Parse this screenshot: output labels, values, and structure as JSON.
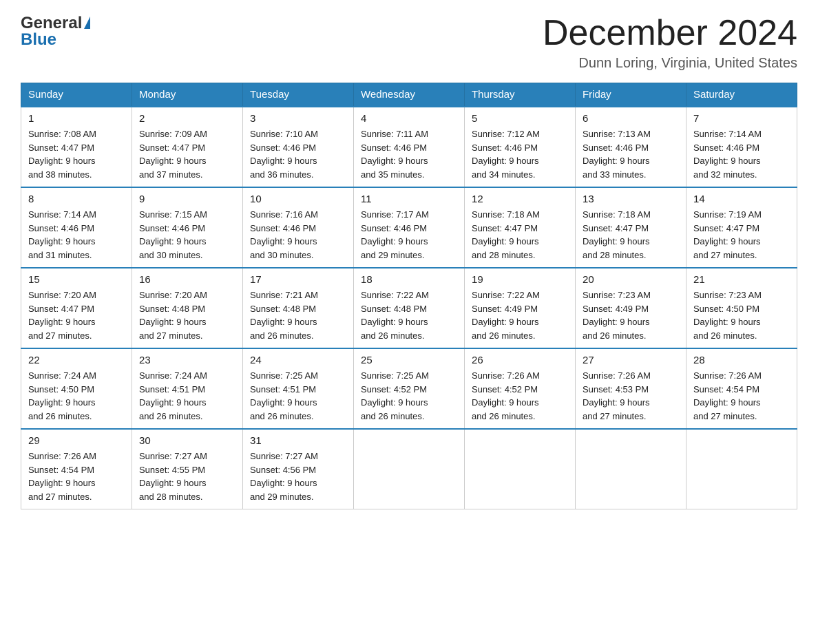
{
  "logo": {
    "line1": "General",
    "triangle": "▶",
    "line2": "Blue"
  },
  "title": "December 2024",
  "location": "Dunn Loring, Virginia, United States",
  "headers": [
    "Sunday",
    "Monday",
    "Tuesday",
    "Wednesday",
    "Thursday",
    "Friday",
    "Saturday"
  ],
  "weeks": [
    [
      {
        "day": "1",
        "sunrise": "7:08 AM",
        "sunset": "4:47 PM",
        "daylight_hours": "9",
        "daylight_minutes": "38"
      },
      {
        "day": "2",
        "sunrise": "7:09 AM",
        "sunset": "4:47 PM",
        "daylight_hours": "9",
        "daylight_minutes": "37"
      },
      {
        "day": "3",
        "sunrise": "7:10 AM",
        "sunset": "4:46 PM",
        "daylight_hours": "9",
        "daylight_minutes": "36"
      },
      {
        "day": "4",
        "sunrise": "7:11 AM",
        "sunset": "4:46 PM",
        "daylight_hours": "9",
        "daylight_minutes": "35"
      },
      {
        "day": "5",
        "sunrise": "7:12 AM",
        "sunset": "4:46 PM",
        "daylight_hours": "9",
        "daylight_minutes": "34"
      },
      {
        "day": "6",
        "sunrise": "7:13 AM",
        "sunset": "4:46 PM",
        "daylight_hours": "9",
        "daylight_minutes": "33"
      },
      {
        "day": "7",
        "sunrise": "7:14 AM",
        "sunset": "4:46 PM",
        "daylight_hours": "9",
        "daylight_minutes": "32"
      }
    ],
    [
      {
        "day": "8",
        "sunrise": "7:14 AM",
        "sunset": "4:46 PM",
        "daylight_hours": "9",
        "daylight_minutes": "31"
      },
      {
        "day": "9",
        "sunrise": "7:15 AM",
        "sunset": "4:46 PM",
        "daylight_hours": "9",
        "daylight_minutes": "30"
      },
      {
        "day": "10",
        "sunrise": "7:16 AM",
        "sunset": "4:46 PM",
        "daylight_hours": "9",
        "daylight_minutes": "30"
      },
      {
        "day": "11",
        "sunrise": "7:17 AM",
        "sunset": "4:46 PM",
        "daylight_hours": "9",
        "daylight_minutes": "29"
      },
      {
        "day": "12",
        "sunrise": "7:18 AM",
        "sunset": "4:47 PM",
        "daylight_hours": "9",
        "daylight_minutes": "28"
      },
      {
        "day": "13",
        "sunrise": "7:18 AM",
        "sunset": "4:47 PM",
        "daylight_hours": "9",
        "daylight_minutes": "28"
      },
      {
        "day": "14",
        "sunrise": "7:19 AM",
        "sunset": "4:47 PM",
        "daylight_hours": "9",
        "daylight_minutes": "27"
      }
    ],
    [
      {
        "day": "15",
        "sunrise": "7:20 AM",
        "sunset": "4:47 PM",
        "daylight_hours": "9",
        "daylight_minutes": "27"
      },
      {
        "day": "16",
        "sunrise": "7:20 AM",
        "sunset": "4:48 PM",
        "daylight_hours": "9",
        "daylight_minutes": "27"
      },
      {
        "day": "17",
        "sunrise": "7:21 AM",
        "sunset": "4:48 PM",
        "daylight_hours": "9",
        "daylight_minutes": "26"
      },
      {
        "day": "18",
        "sunrise": "7:22 AM",
        "sunset": "4:48 PM",
        "daylight_hours": "9",
        "daylight_minutes": "26"
      },
      {
        "day": "19",
        "sunrise": "7:22 AM",
        "sunset": "4:49 PM",
        "daylight_hours": "9",
        "daylight_minutes": "26"
      },
      {
        "day": "20",
        "sunrise": "7:23 AM",
        "sunset": "4:49 PM",
        "daylight_hours": "9",
        "daylight_minutes": "26"
      },
      {
        "day": "21",
        "sunrise": "7:23 AM",
        "sunset": "4:50 PM",
        "daylight_hours": "9",
        "daylight_minutes": "26"
      }
    ],
    [
      {
        "day": "22",
        "sunrise": "7:24 AM",
        "sunset": "4:50 PM",
        "daylight_hours": "9",
        "daylight_minutes": "26"
      },
      {
        "day": "23",
        "sunrise": "7:24 AM",
        "sunset": "4:51 PM",
        "daylight_hours": "9",
        "daylight_minutes": "26"
      },
      {
        "day": "24",
        "sunrise": "7:25 AM",
        "sunset": "4:51 PM",
        "daylight_hours": "9",
        "daylight_minutes": "26"
      },
      {
        "day": "25",
        "sunrise": "7:25 AM",
        "sunset": "4:52 PM",
        "daylight_hours": "9",
        "daylight_minutes": "26"
      },
      {
        "day": "26",
        "sunrise": "7:26 AM",
        "sunset": "4:52 PM",
        "daylight_hours": "9",
        "daylight_minutes": "26"
      },
      {
        "day": "27",
        "sunrise": "7:26 AM",
        "sunset": "4:53 PM",
        "daylight_hours": "9",
        "daylight_minutes": "27"
      },
      {
        "day": "28",
        "sunrise": "7:26 AM",
        "sunset": "4:54 PM",
        "daylight_hours": "9",
        "daylight_minutes": "27"
      }
    ],
    [
      {
        "day": "29",
        "sunrise": "7:26 AM",
        "sunset": "4:54 PM",
        "daylight_hours": "9",
        "daylight_minutes": "27"
      },
      {
        "day": "30",
        "sunrise": "7:27 AM",
        "sunset": "4:55 PM",
        "daylight_hours": "9",
        "daylight_minutes": "28"
      },
      {
        "day": "31",
        "sunrise": "7:27 AM",
        "sunset": "4:56 PM",
        "daylight_hours": "9",
        "daylight_minutes": "29"
      },
      null,
      null,
      null,
      null
    ]
  ]
}
